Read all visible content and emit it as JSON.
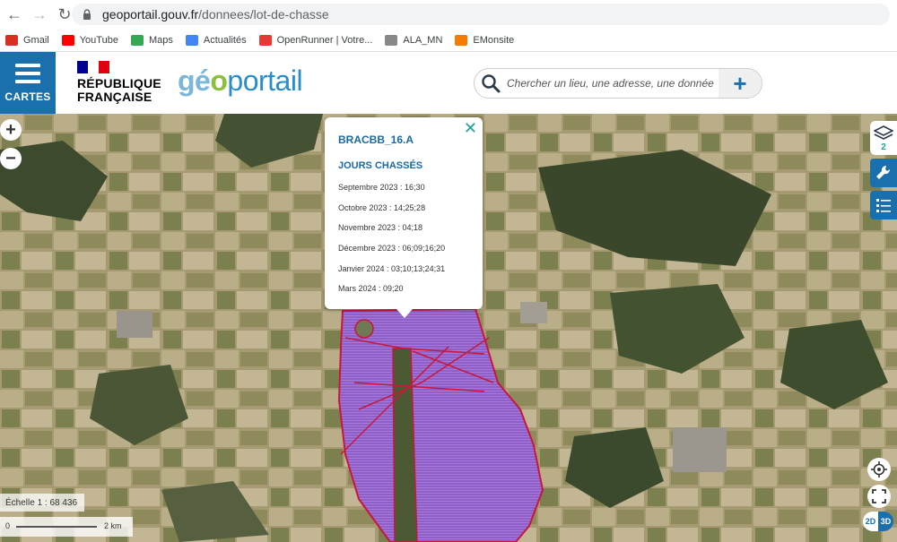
{
  "browser": {
    "url_host": "geoportail.gouv.fr",
    "url_path": "/donnees/lot-de-chasse",
    "bookmarks": [
      {
        "label": "Gmail",
        "icon": "gmail-icon",
        "color": "#d93025"
      },
      {
        "label": "YouTube",
        "icon": "youtube-icon",
        "color": "#ff0000"
      },
      {
        "label": "Maps",
        "icon": "maps-icon",
        "color": "#34a853"
      },
      {
        "label": "Actualités",
        "icon": "news-icon",
        "color": "#4285f4"
      },
      {
        "label": "OpenRunner | Votre...",
        "icon": "openrunner-icon",
        "color": "#e53935"
      },
      {
        "label": "ALA_MN",
        "icon": "ala-icon",
        "color": "#888888"
      },
      {
        "label": "EMonsite",
        "icon": "emonsite-icon",
        "color": "#f57c00"
      }
    ]
  },
  "header": {
    "cartes_label": "CARTES",
    "rf_line1": "RÉPUBLIQUE",
    "rf_line2": "FRANÇAISE",
    "logo_part1": "gé",
    "logo_part2": "o",
    "logo_part3": "portail",
    "search_placeholder": "Chercher un lieu, une adresse, une donnée",
    "accent_color": "#1a70ad"
  },
  "popup": {
    "title": "BRACBB_16.A",
    "subtitle": "JOURS CHASSÉS",
    "rows": [
      "Septembre 2023 : 16;30",
      "Octobre 2023 : 14;25;28",
      "Novembre 2023 : 04;18",
      "Décembre 2023 : 06;09;16;20",
      "Janvier 2024 : 03;10;13;24;31",
      "Mars 2024 : 09;20"
    ]
  },
  "map": {
    "layer_count": "2",
    "scale_text": "Échelle 1 : 68 436",
    "scale_start": "0",
    "scale_end": "2 km",
    "btn_2d": "2D",
    "btn_3d": "3D",
    "zone_fill": "#8e5fc9",
    "zone_stroke": "#c8163c"
  }
}
